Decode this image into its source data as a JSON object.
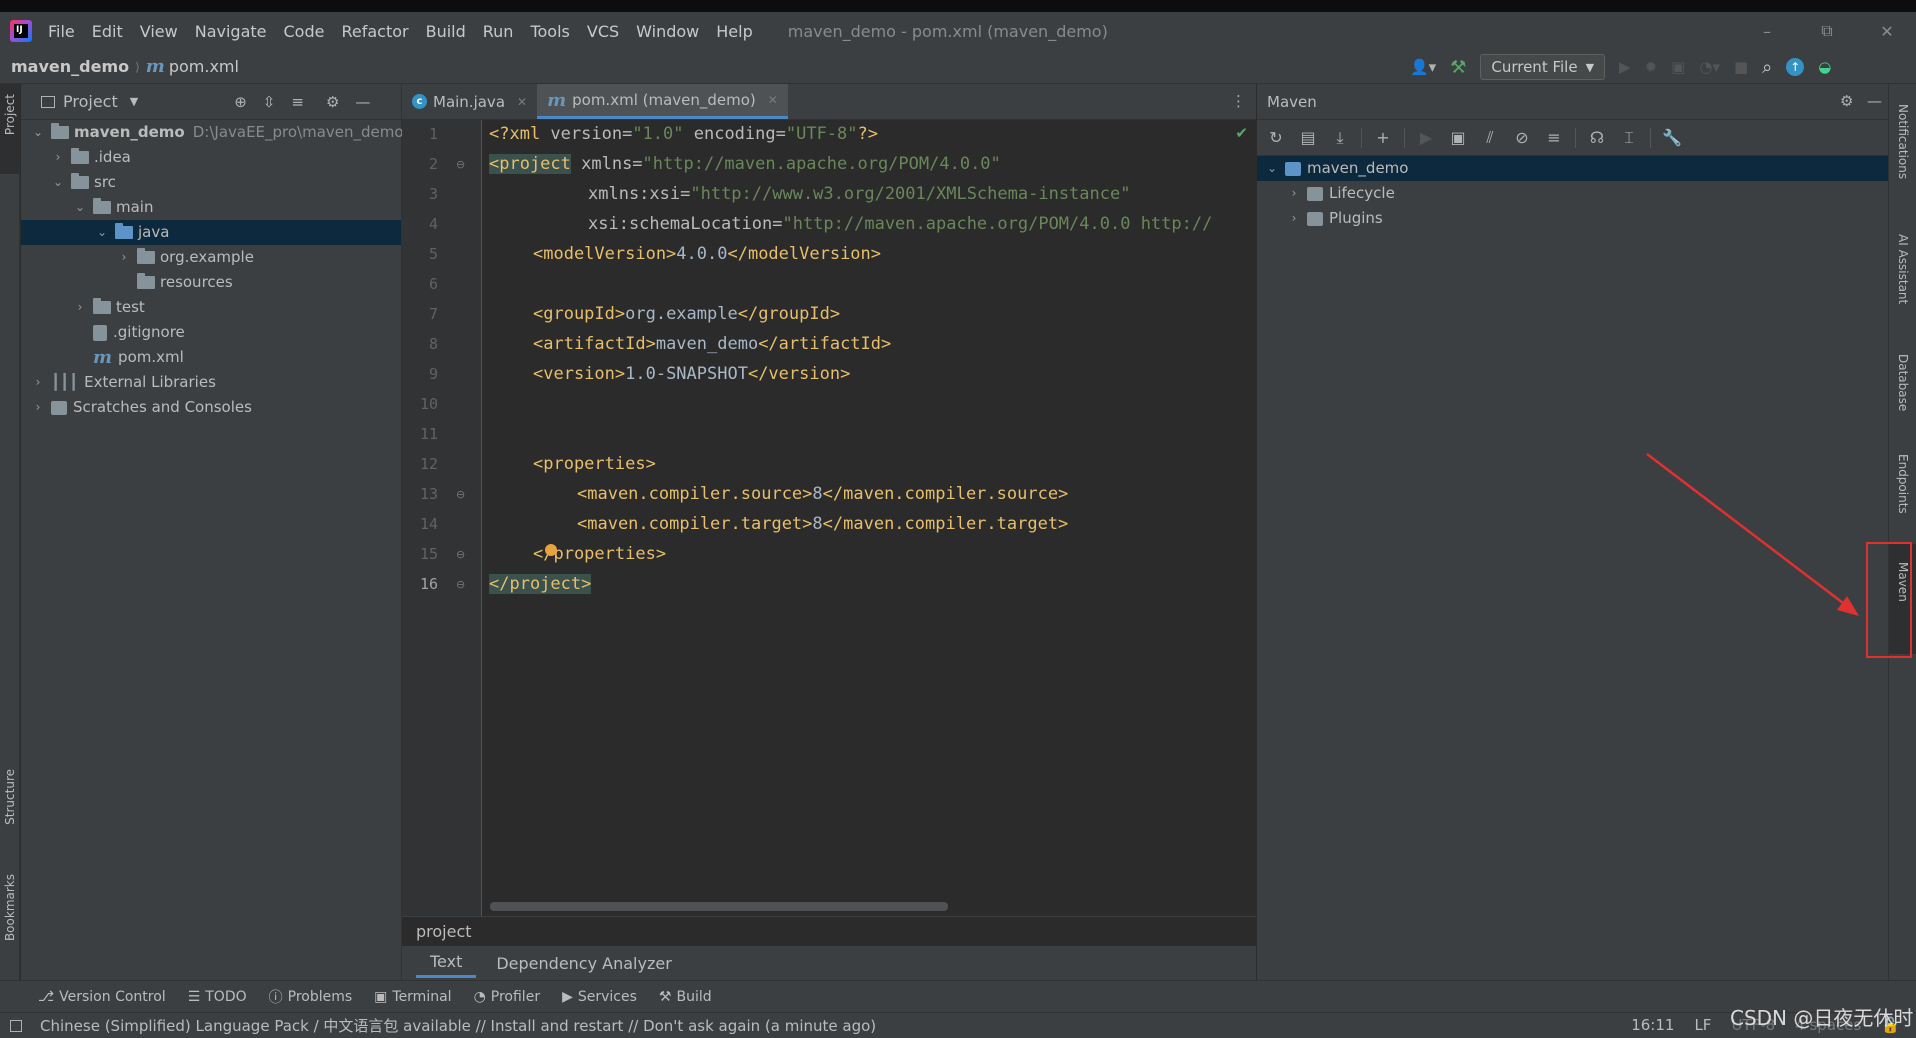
{
  "window": {
    "title": "maven_demo - pom.xml (maven_demo)",
    "minimize_icon": "minimize-icon",
    "restore_icon": "restore-icon",
    "close_icon": "close-icon"
  },
  "menu": [
    "File",
    "Edit",
    "View",
    "Navigate",
    "Code",
    "Refactor",
    "Build",
    "Run",
    "Tools",
    "VCS",
    "Window",
    "Help"
  ],
  "navbar": {
    "project": "maven_demo",
    "file": "pom.xml",
    "run_config": "Current File"
  },
  "left_stripe": {
    "project": "Project",
    "structure": "Structure",
    "bookmarks": "Bookmarks"
  },
  "right_stripe": {
    "notifications": "Notifications",
    "ai_assistant": "AI Assistant",
    "database": "Database",
    "endpoints": "Endpoints",
    "maven": "Maven"
  },
  "project_panel": {
    "title": "Project",
    "tree": {
      "root": "maven_demo",
      "root_path": "D:\\JavaEE_pro\\maven_demo",
      "idea": ".idea",
      "src": "src",
      "main": "main",
      "java": "java",
      "org_example": "org.example",
      "resources": "resources",
      "test": "test",
      "gitignore": ".gitignore",
      "pom": "pom.xml",
      "external_libraries": "External Libraries",
      "scratches": "Scratches and Consoles"
    }
  },
  "editor": {
    "tabs": [
      {
        "label": "Main.java",
        "active": false
      },
      {
        "label": "pom.xml (maven_demo)",
        "active": true
      }
    ],
    "line_numbers": [
      "1",
      "2",
      "3",
      "4",
      "5",
      "6",
      "7",
      "8",
      "9",
      "10",
      "11",
      "12",
      "13",
      "14",
      "15",
      "16"
    ],
    "code": {
      "l1": {
        "decl": "<?xml ",
        "a1": "version=",
        "v1": "\"1.0\"",
        "a2": " encoding=",
        "v2": "\"UTF-8\"",
        "end": "?>"
      },
      "l2": {
        "open": "<project",
        "a": " xmlns=",
        "v": "\"http://maven.apache.org/POM/4.0.0\""
      },
      "l3": {
        "a": "xmlns:xsi=",
        "v": "\"http://www.w3.org/2001/XMLSchema-instance\""
      },
      "l4": {
        "a": "xsi:schemaLocation=",
        "v": "\"http://maven.apache.org/POM/4.0.0 http://"
      },
      "l5": {
        "o": "<modelVersion>",
        "t": "4.0.0",
        "c": "</modelVersion>"
      },
      "l7": {
        "o": "<groupId>",
        "t": "org.example",
        "c": "</groupId>"
      },
      "l8": {
        "o": "<artifactId>",
        "t": "maven_demo",
        "c": "</artifactId>"
      },
      "l9": {
        "o": "<version>",
        "t": "1.0-SNAPSHOT",
        "c": "</version>"
      },
      "l12": {
        "o": "<properties>"
      },
      "l13": {
        "o": "<maven.compiler.source>",
        "t": "8",
        "c": "</maven.compiler.source>"
      },
      "l14": {
        "o": "<maven.compiler.target>",
        "t": "8",
        "c": "</maven.compiler.target>"
      },
      "l15": {
        "c": "</properties>"
      },
      "l16": {
        "c": "</project>"
      }
    },
    "breadcrumb": "project",
    "bottom_tabs": [
      "Text",
      "Dependency Analyzer"
    ]
  },
  "maven_panel": {
    "title": "Maven",
    "tree": {
      "root": "maven_demo",
      "lifecycle": "Lifecycle",
      "plugins": "Plugins"
    }
  },
  "bottom_toolbar": [
    "Version Control",
    "TODO",
    "Problems",
    "Terminal",
    "Profiler",
    "Services",
    "Build"
  ],
  "status": {
    "message": "Chinese (Simplified) Language Pack / 中文语言包 available // Install and restart // Don't ask again (a minute ago)",
    "position": "16:11",
    "line_sep": "LF",
    "encoding": "UTF-8",
    "indent": "4 spaces",
    "watermark": "CSDN @日夜无休时"
  },
  "colors": {
    "accent": "#4a88c7",
    "highlight_box": "#e03131",
    "xml_tag": "#e8bf6a",
    "xml_value": "#6a8759"
  }
}
